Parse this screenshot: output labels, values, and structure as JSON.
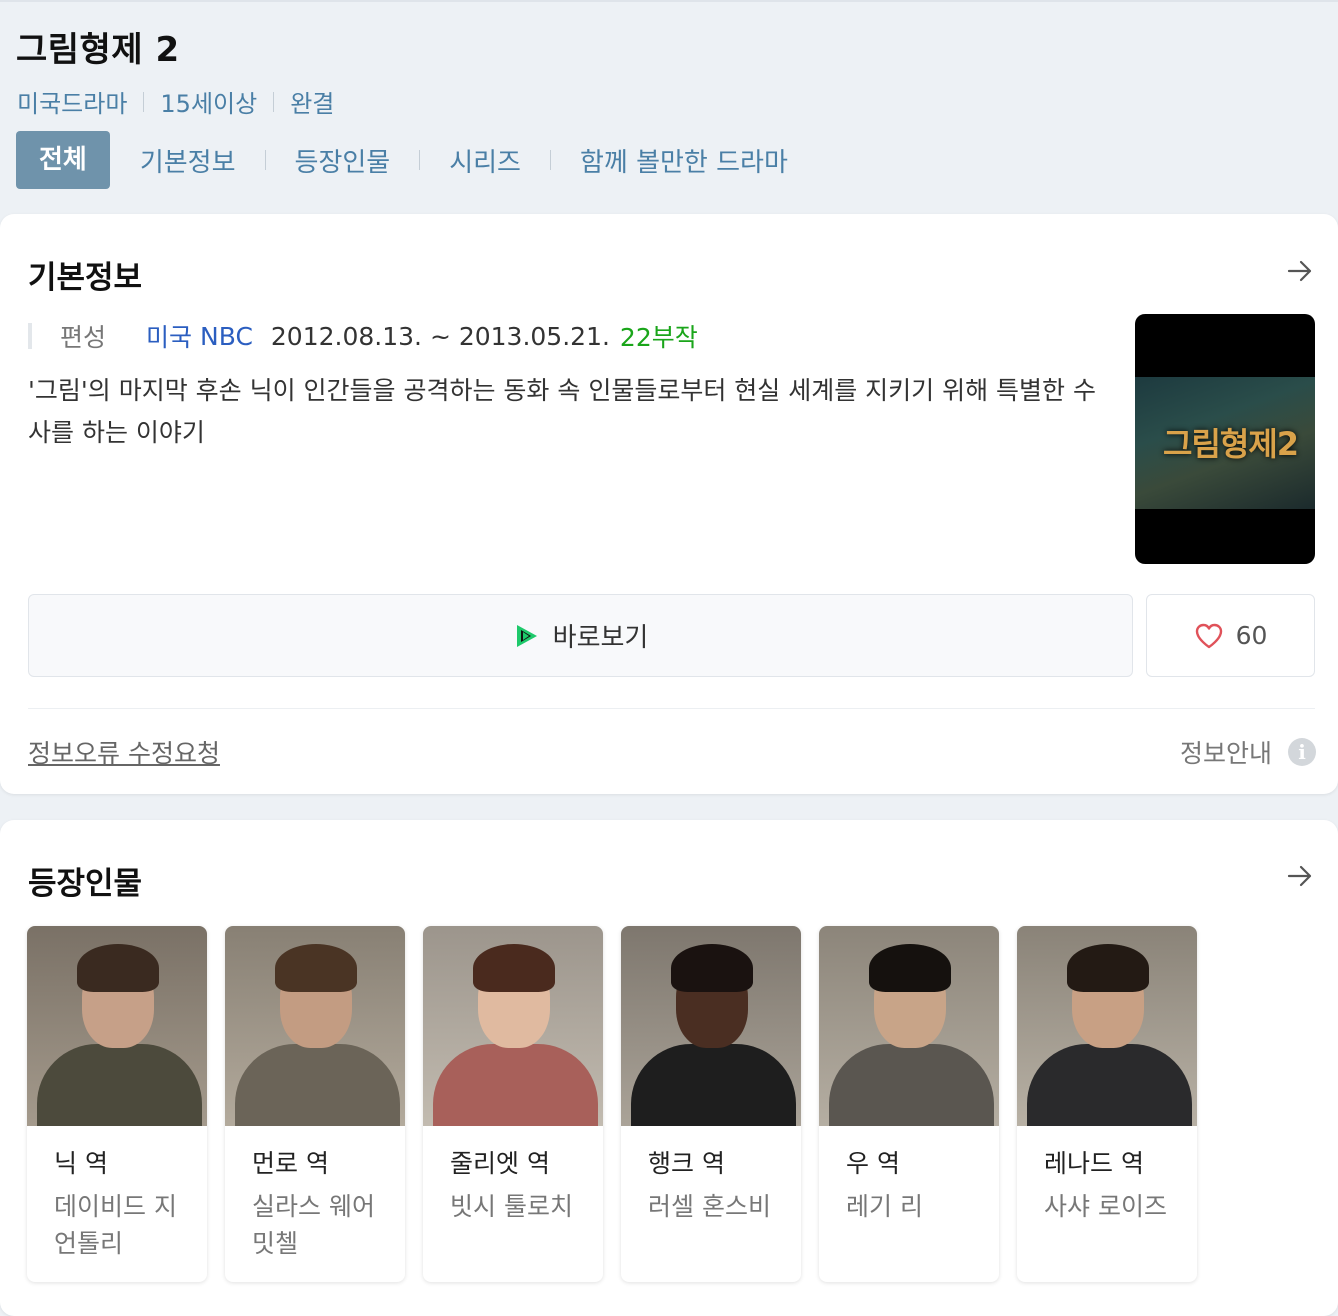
{
  "header": {
    "title": "그림형제 2",
    "meta": [
      "미국드라마",
      "15세이상",
      "완결"
    ],
    "tabs": [
      "전체",
      "기본정보",
      "등장인물",
      "시리즈",
      "함께 볼만한 드라마"
    ]
  },
  "basic_info": {
    "section_title": "기본정보",
    "label": "편성",
    "country": "미국",
    "network": "NBC",
    "dates": "2012.08.13. ~ 2013.05.21.",
    "episodes": "22부작",
    "synopsis": "'그림'의 마지막 후손 닉이 인간들을 공격하는 동화 속 인물들로부터 현실 세계를 지키기 위해 특별한 수사를 하는 이야기",
    "poster_logo": "그림형제2",
    "watch_label": "바로보기",
    "like_count": "60",
    "report_link": "정보오류 수정요청",
    "info_guide": "정보안내"
  },
  "cast": {
    "section_title": "등장인물",
    "members": [
      {
        "role": "닉 역",
        "actor": "데이비드 지언톨리"
      },
      {
        "role": "먼로 역",
        "actor": "실라스 웨어 밋첼"
      },
      {
        "role": "줄리엣 역",
        "actor": "빗시 툴로치"
      },
      {
        "role": "행크 역",
        "actor": "러셀 혼스비"
      },
      {
        "role": "우 역",
        "actor": "레기 리"
      },
      {
        "role": "레나드 역",
        "actor": "사샤 로이즈"
      }
    ]
  },
  "colors": {
    "accent": "#6f93ab",
    "link": "#4a7fa6",
    "episodes": "#1aa51a",
    "like": "#e0525a"
  }
}
